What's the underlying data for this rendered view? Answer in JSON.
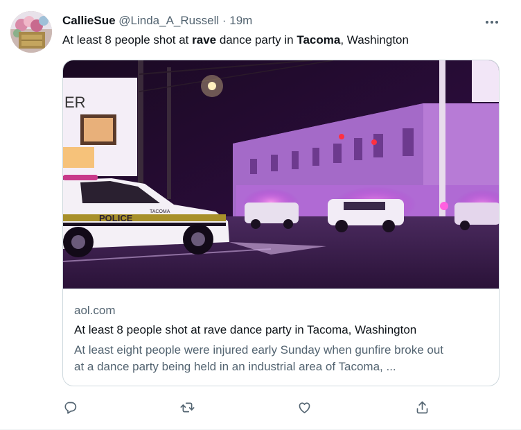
{
  "tweet": {
    "author_name": "CallieSue",
    "author_handle": "@Linda_A_Russell",
    "separator": "·",
    "time": "19m",
    "text_parts": {
      "p1": "At least 8 people shot at ",
      "b1": "rave",
      "p2": " dance party in ",
      "b2": "Tacoma",
      "p3": ", Washington"
    }
  },
  "card": {
    "domain": "aol.com",
    "title": "At least 8 people shot at rave dance party in Tacoma, Washington",
    "description_line1": "At least eight people were injured early Sunday when gunfire broke out",
    "description_line2": "at a dance party being held in an industrial area of Tacoma, ...",
    "image_sign_text": "ER",
    "image_vehicle_text": "POLICE",
    "image_vehicle_brand": "TACOMA"
  },
  "actions": [
    "reply-icon",
    "retweet-icon",
    "like-icon",
    "share-icon"
  ],
  "colors": {
    "text_primary": "#0f1419",
    "text_secondary": "#536471",
    "border": "#cfd9de"
  }
}
